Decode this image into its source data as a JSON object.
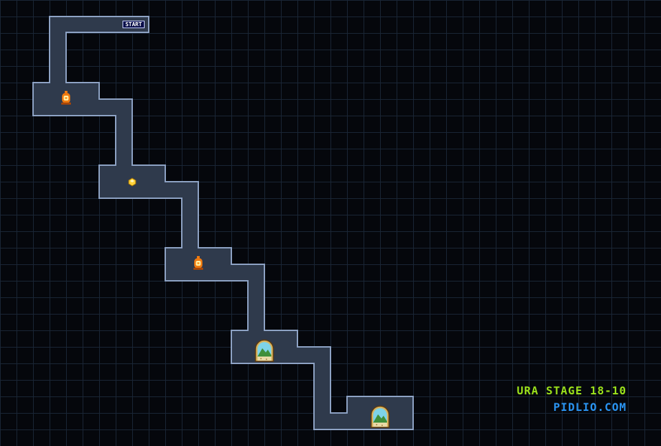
{
  "map": {
    "start_label": "START",
    "stage_title": "URA STAGE 18-10",
    "site_label": "PIDLIO.COM"
  },
  "items": [
    {
      "kind": "lantern-item",
      "icon": "lantern-icon"
    },
    {
      "kind": "gem-item",
      "icon": "gem-icon"
    },
    {
      "kind": "lantern-item",
      "icon": "lantern-icon"
    },
    {
      "kind": "exit-door",
      "icon": "arched-door-icon"
    },
    {
      "kind": "exit-door",
      "icon": "arched-door-icon"
    }
  ],
  "colors": {
    "floor": "#2f3a4c",
    "wall": "#8fa4c6",
    "grid": "#1a2636",
    "background": "#05070c",
    "title_green": "#9be01b",
    "site_blue": "#2a93f0",
    "lantern_orange": "#f07a10",
    "gem_yellow": "#ffd23a"
  }
}
